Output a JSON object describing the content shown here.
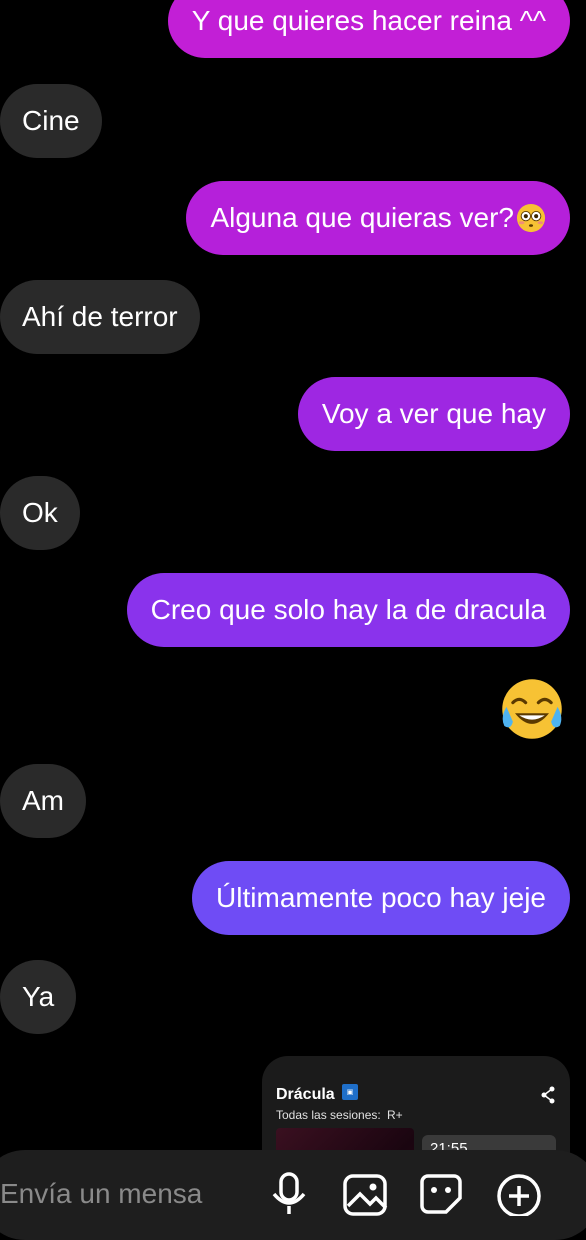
{
  "messages": [
    {
      "id": "m1",
      "direction": "outgoing",
      "text": "Y que quieres hacer reina ^^",
      "emoji": ""
    },
    {
      "id": "m2",
      "direction": "incoming",
      "text": "Cine",
      "emoji": ""
    },
    {
      "id": "m3",
      "direction": "outgoing",
      "text": "Alguna que quieras ver?",
      "emoji": "flushed-face"
    },
    {
      "id": "m4",
      "direction": "incoming",
      "text": "Ahí de terror",
      "emoji": ""
    },
    {
      "id": "m5",
      "direction": "outgoing",
      "text": "Voy a ver que hay",
      "emoji": ""
    },
    {
      "id": "m6",
      "direction": "incoming",
      "text": "Ok",
      "emoji": ""
    },
    {
      "id": "m7",
      "direction": "outgoing",
      "text": "Creo que solo hay la de dracula",
      "emoji": ""
    },
    {
      "id": "m8",
      "direction": "outgoing",
      "text": "",
      "emoji": "face-with-tears-of-joy"
    },
    {
      "id": "m9",
      "direction": "incoming",
      "text": "Am",
      "emoji": ""
    },
    {
      "id": "m10",
      "direction": "outgoing",
      "text": "Últimamente poco hay jeje",
      "emoji": ""
    },
    {
      "id": "m11",
      "direction": "incoming",
      "text": "Ya",
      "emoji": ""
    }
  ],
  "shared_card": {
    "title": "Drácula",
    "subtitle": "Todas las sesiones:",
    "rating": "R+",
    "time": "21:55",
    "share_icon": "share-icon"
  },
  "composer": {
    "placeholder": "Envía un mensa",
    "icons": [
      "microphone-icon",
      "image-icon",
      "sticker-icon",
      "plus-icon"
    ]
  },
  "colors": {
    "incoming_bubble": "#2a2a2a",
    "outgoing_gradient_top": "#c21fd6",
    "outgoing_gradient_bottom": "#6f4cf5",
    "background": "#000000"
  }
}
